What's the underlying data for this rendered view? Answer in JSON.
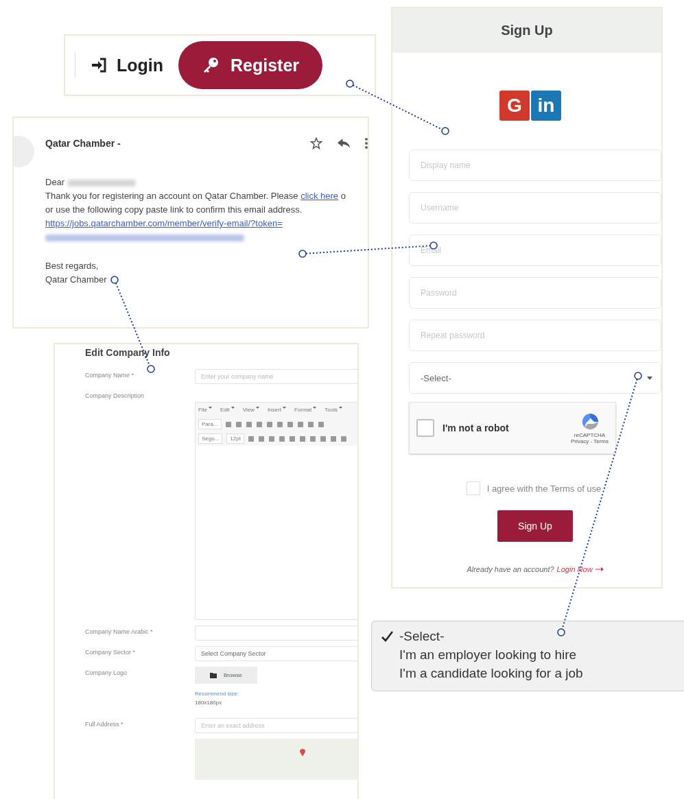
{
  "auth_bar": {
    "login": "Login",
    "register": "Register"
  },
  "email": {
    "sender": "Qatar Chamber -",
    "greeting": "Dear",
    "body_before": "Thank you for registering an account on Qatar Chamber. Please ",
    "body_link": "click here",
    "body_after": " o",
    "line2": "or use the following copy paste link to confirm this email address.",
    "url": "https://jobs.qatarchamber.com/member/verify-email/?token=",
    "closing": "Best regards,",
    "signature": "Qatar Chamber"
  },
  "company_form": {
    "title": "Edit Company Info",
    "rows": [
      {
        "kind": "text",
        "label": "Company Name *",
        "placeholder": "Enter your company name"
      },
      {
        "kind": "editor",
        "label": "Company Description",
        "menu": [
          "File",
          "Edit",
          "View",
          "Insert",
          "Format",
          "Tools"
        ],
        "paragraph": "Para...",
        "font": "Sego...",
        "size": "12pt"
      },
      {
        "kind": "text",
        "label": "Company Name Arabic *"
      },
      {
        "kind": "select",
        "label": "Company Sector *",
        "value": "Select Company Sector"
      },
      {
        "kind": "file",
        "label": "Company Logo",
        "button": "Browse",
        "hint": "Recommend size:",
        "hint2": "180x180px"
      },
      {
        "kind": "address",
        "label": "Full Address *",
        "placeholder": "Enter an exact address"
      }
    ]
  },
  "signup": {
    "title": "Sign Up",
    "fields": [
      {
        "placeholder": "Display name"
      },
      {
        "placeholder": "Username"
      },
      {
        "placeholder": "Email"
      },
      {
        "placeholder": "Password"
      },
      {
        "placeholder": "Repeat password"
      }
    ],
    "social": [
      {
        "kind": "google",
        "label": "G"
      },
      {
        "kind": "linkedin",
        "label": "in"
      }
    ],
    "select": "-Select-",
    "captcha": {
      "label": "I'm not a robot",
      "brand": "reCAPTCHA",
      "links": "Privacy - Terms",
      "checked": false
    },
    "terms": {
      "label": "I agree with the Terms of use",
      "checked": false
    },
    "button": "Sign Up",
    "footer": "Already have an account?",
    "footer_link": "Login Now"
  },
  "dropdown": {
    "options": [
      {
        "label": "-Select-",
        "selected": true
      },
      {
        "label": "I'm an employer looking to hire",
        "selected": false
      },
      {
        "label": "I'm a candidate looking for a job",
        "selected": false
      }
    ]
  }
}
